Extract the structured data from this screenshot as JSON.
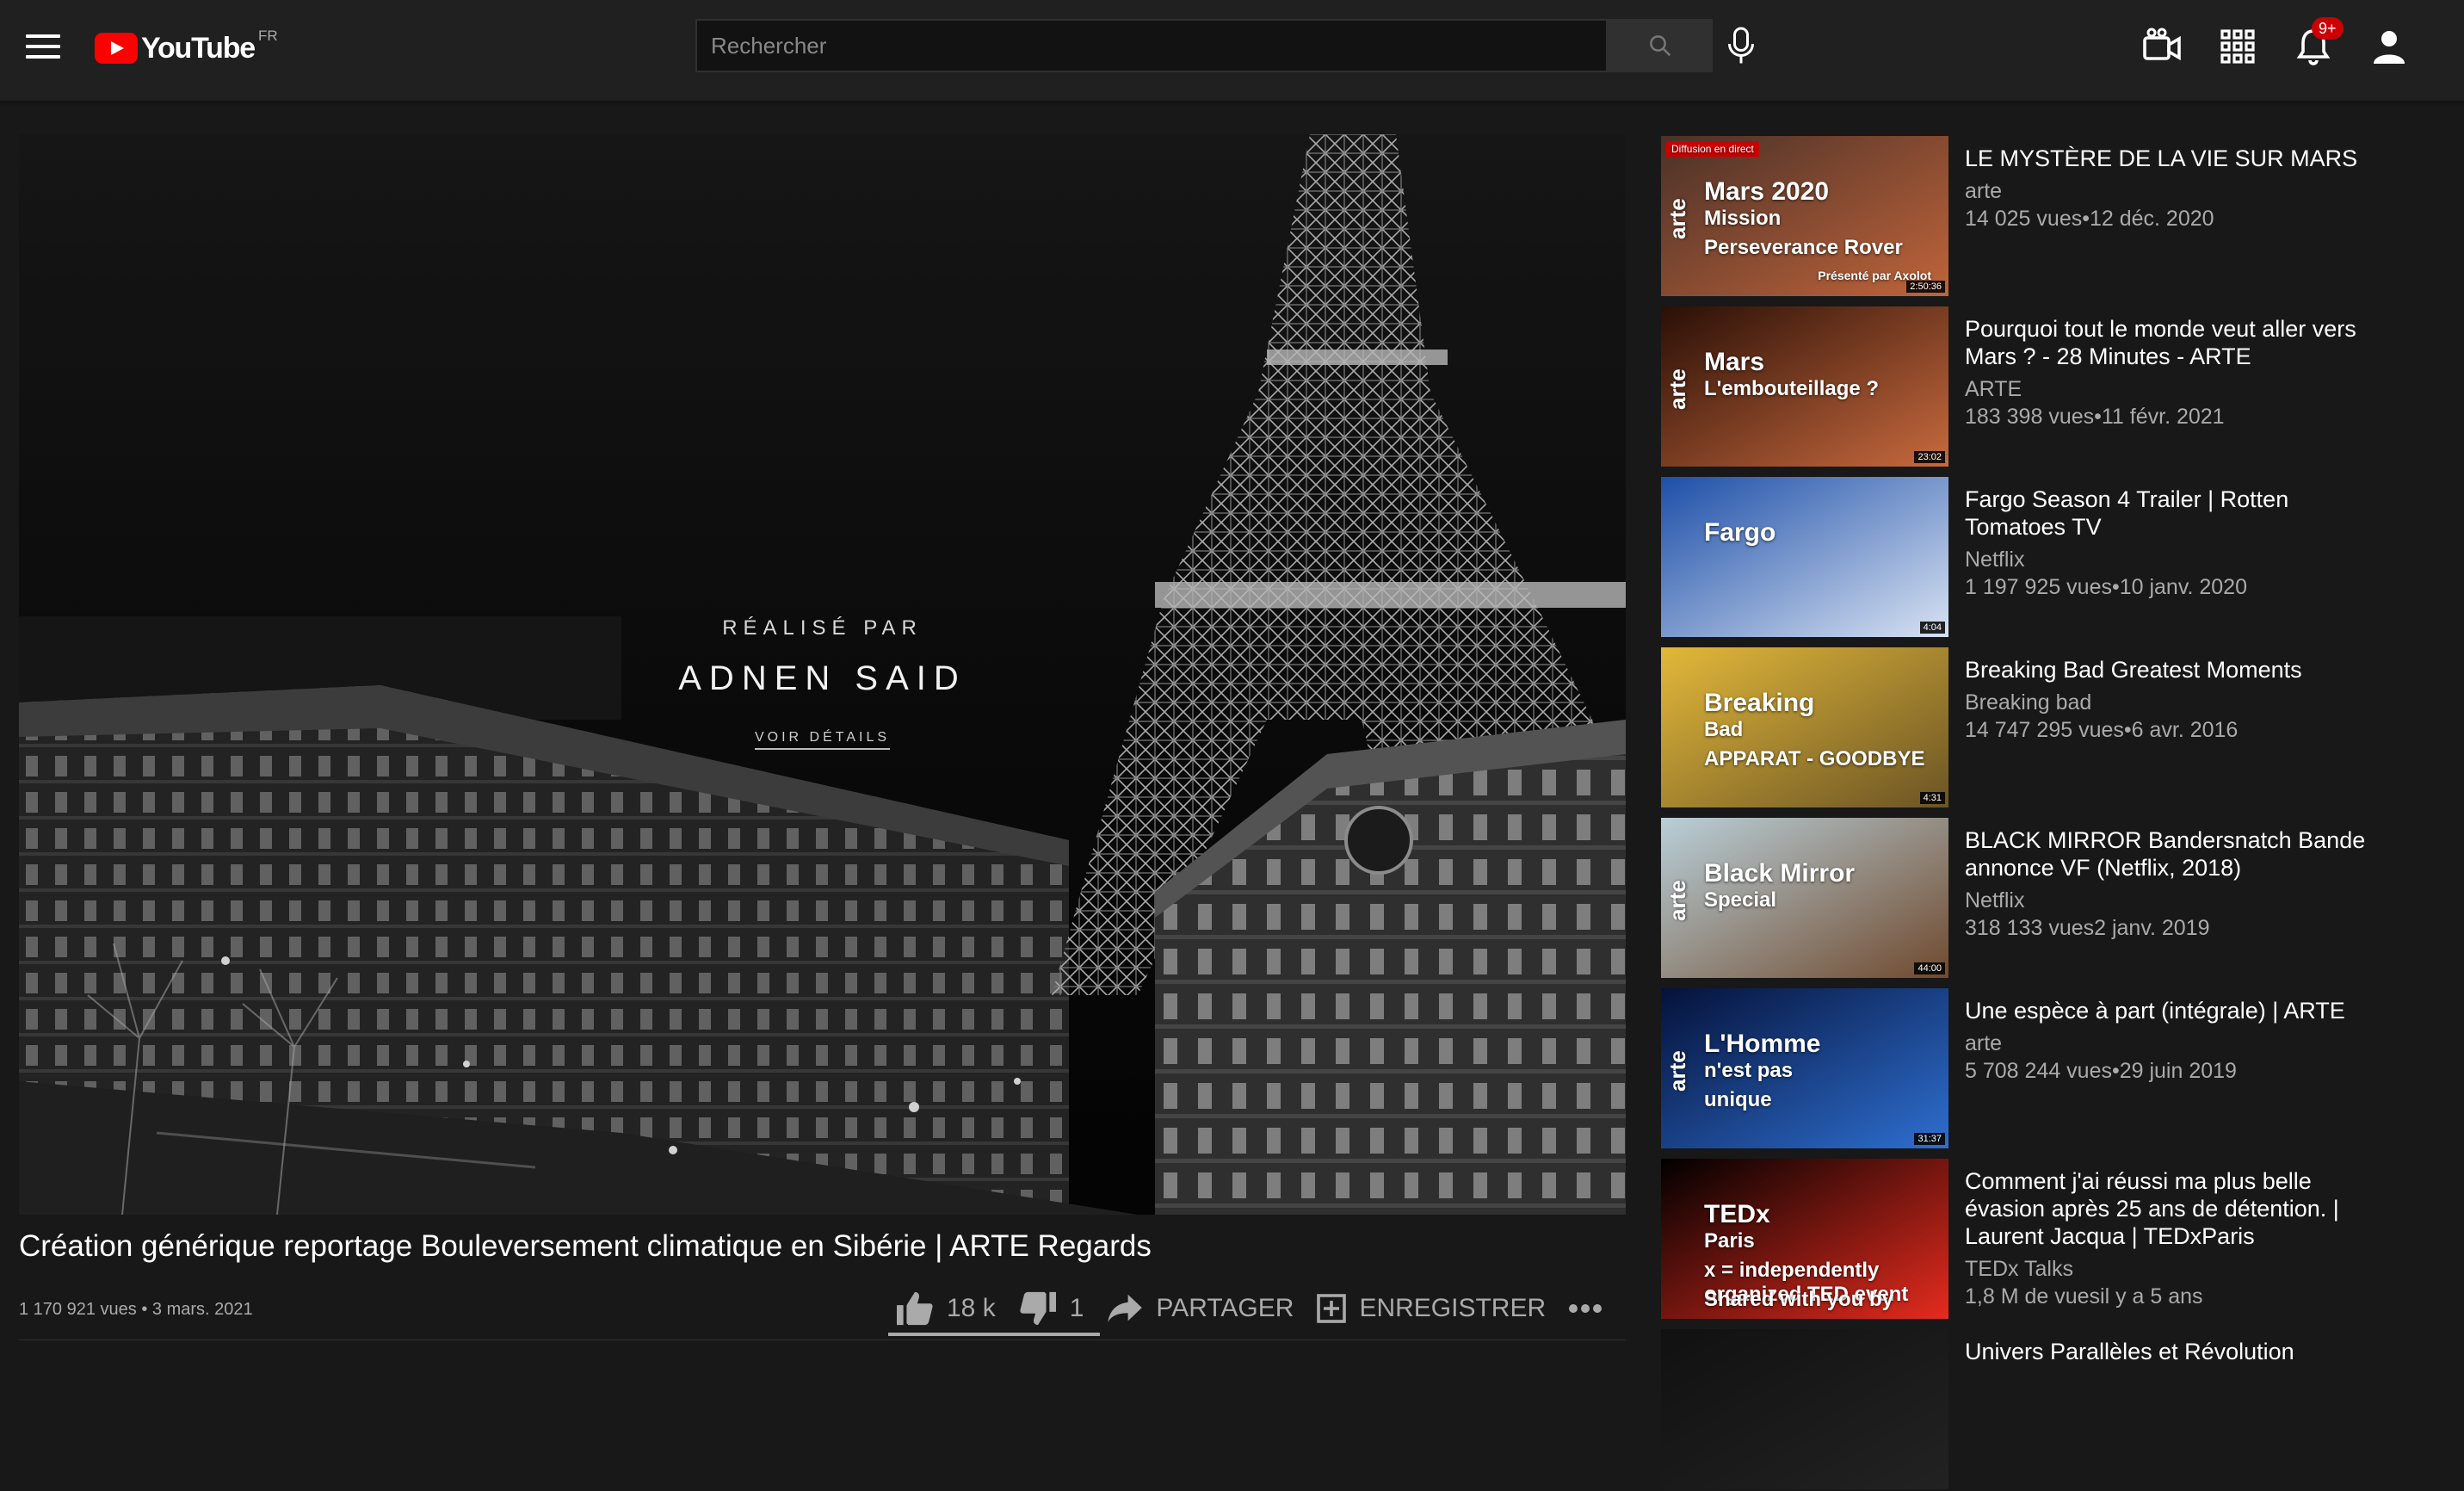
{
  "header": {
    "logo_text": "YouTube",
    "logo_country": "FR",
    "search_placeholder": "Rechercher",
    "notifications_badge": "9+",
    "icons": [
      "menu-icon",
      "search-icon",
      "mic-icon",
      "create-video-icon",
      "apps-grid-icon",
      "bell-icon",
      "account-icon"
    ]
  },
  "player": {
    "overlay_sub": "RÉALISÉ PAR",
    "overlay_name": "ADNEN SAID",
    "overlay_link": "VOIR DÉTAILS"
  },
  "video": {
    "title": "Création générique reportage Bouleversement climatique en Sibérie | ARTE Regards",
    "meta": "1 170 921 vues • 3 mars. 2021",
    "likes": "18 k",
    "dislikes": "1",
    "share_label": "PARTAGER",
    "save_label": "ENREGISTRER",
    "like_ratio": 0.9999
  },
  "recommendations": [
    {
      "title": "LE MYSTÈRE DE LA VIE SUR MARS",
      "channel": "arte",
      "stats": "14 025 vues•12 déc. 2020",
      "duration": "2:50:36",
      "thumb": {
        "badge": "Diffusion en direct",
        "lines": [
          "Mars 2020",
          "Mission",
          "Perseverance Rover"
        ],
        "brand": "arte",
        "footer": "Présenté par Axolot",
        "colors": [
          "#4a3128",
          "#c0643a"
        ]
      }
    },
    {
      "title": "Pourquoi tout le monde veut aller vers Mars ? - 28 Minutes - ARTE",
      "channel": "ARTE",
      "stats": "183 398 vues•11 févr. 2021",
      "duration": "23:02",
      "thumb": {
        "lines": [
          "Mars",
          "L'embouteillage ?"
        ],
        "brand": "arte",
        "colors": [
          "#2a0f06",
          "#c86a3e"
        ]
      }
    },
    {
      "title": "Fargo Season 4 Trailer | Rotten Tomatoes TV",
      "channel": "Netflix",
      "stats": "1 197 925 vues•10 janv. 2020",
      "duration": "4:04",
      "thumb": {
        "lines": [
          "Fargo"
        ],
        "colors": [
          "#1d4fa8",
          "#d8e2f2"
        ]
      }
    },
    {
      "title": "Breaking Bad Greatest Moments",
      "channel": "Breaking bad",
      "stats": "14 747 295 vues•6 avr. 2016",
      "duration": "4:31",
      "thumb": {
        "lines": [
          "Breaking",
          "Bad",
          "APPARAT - GOODBYE"
        ],
        "colors": [
          "#e2b83a",
          "#6b5424"
        ]
      }
    },
    {
      "title": "BLACK MIRROR Bandersnatch Bande annonce VF (Netflix, 2018)",
      "channel": "Netflix",
      "stats": "318 133 vues2 janv. 2019",
      "duration": "44:00",
      "thumb": {
        "lines": [
          "Black Mirror",
          "Special"
        ],
        "brand": "arte",
        "colors": [
          "#b9cfd8",
          "#6f4a2e"
        ]
      }
    },
    {
      "title": "Une espèce à part (intégrale) | ARTE",
      "channel": "arte",
      "stats": "5 708 244 vues•29 juin 2019",
      "duration": "31:37",
      "thumb": {
        "lines": [
          "L'Homme",
          "n'est pas",
          "unique"
        ],
        "brand": "arte",
        "colors": [
          "#05123a",
          "#2e6fd0"
        ]
      }
    },
    {
      "title": "Comment j'ai réussi ma plus belle évasion après 25 ans de détention. | Laurent Jacqua | TEDxParis",
      "channel": "TEDx Talks",
      "stats": "1,8 M de vuesil y a 5 ans",
      "duration": "",
      "thumb": {
        "lines": [
          "TEDx",
          "Paris",
          "x = independently organized TED event",
          "Shared with you by"
        ],
        "colors": [
          "#000000",
          "#e62b1e"
        ]
      }
    },
    {
      "title": "Univers Parallèles et Révolution",
      "channel": "",
      "stats": "",
      "duration": "",
      "thumb": {
        "lines": [],
        "colors": [
          "#111111",
          "#222222"
        ]
      }
    }
  ]
}
